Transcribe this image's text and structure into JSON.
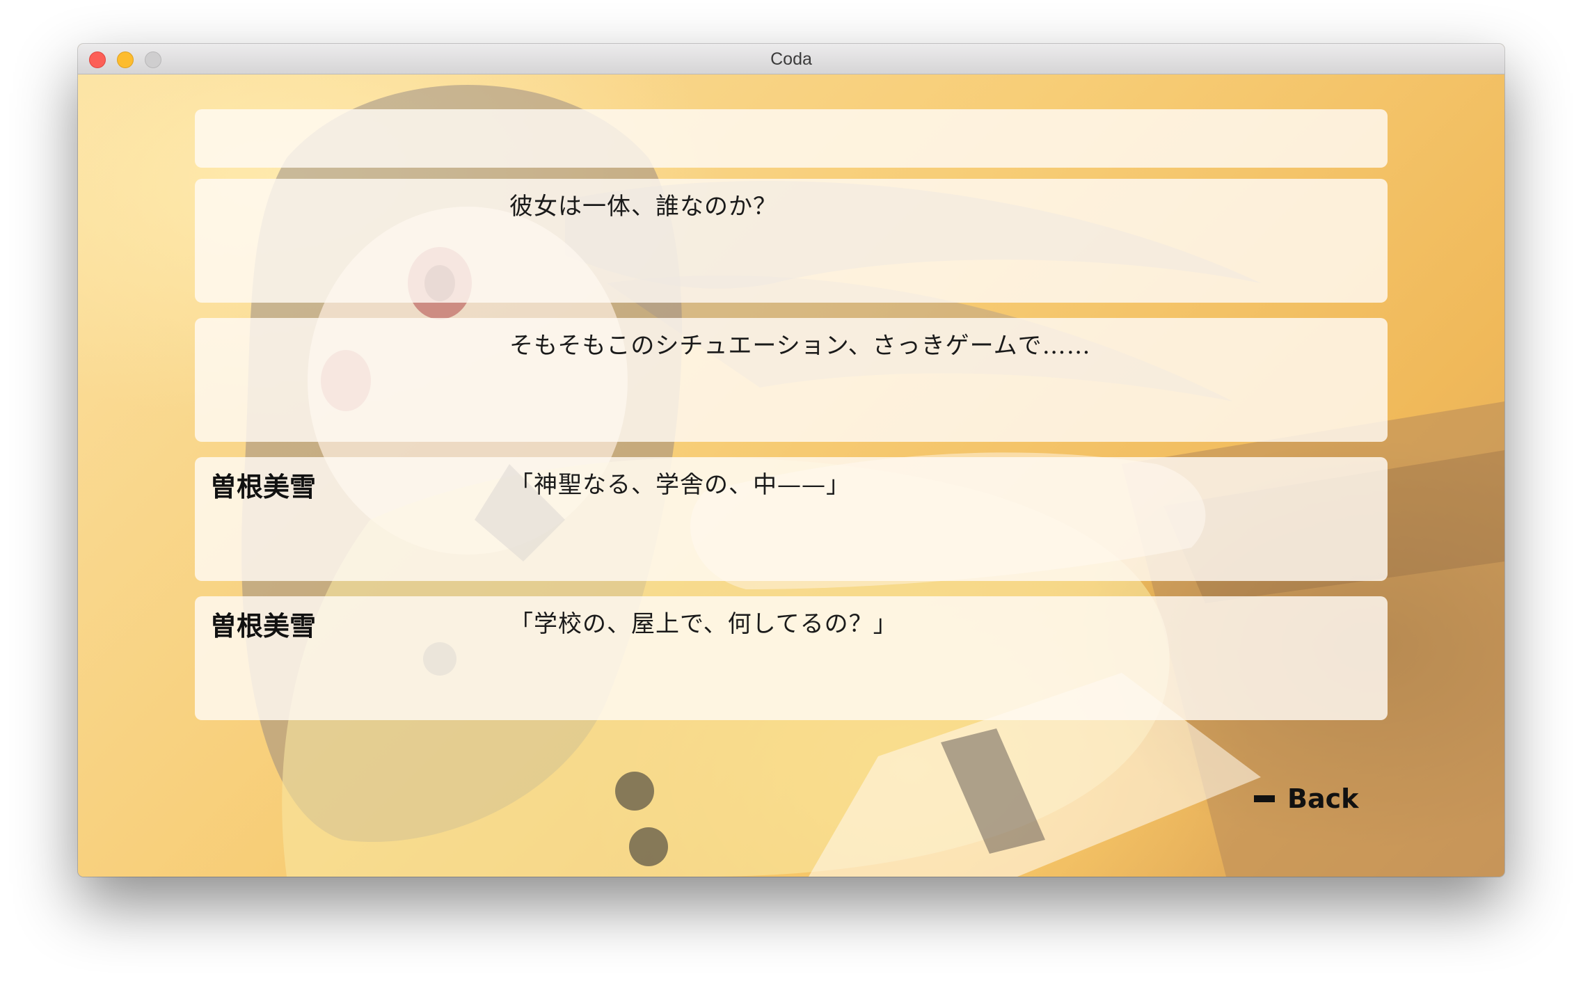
{
  "window": {
    "title": "Coda"
  },
  "history_log": [
    {
      "speaker": "",
      "text": ""
    },
    {
      "speaker": "",
      "text": "彼女は一体、誰なのか？"
    },
    {
      "speaker": "",
      "text": "そもそもこのシチュエーション、さっきゲームで……"
    },
    {
      "speaker": "曽根美雪",
      "text": "「神聖なる、学舎の、中——」"
    },
    {
      "speaker": "曽根美雪",
      "text": "「学校の、屋上で、何してるの？」"
    }
  ],
  "controls": {
    "back_label": "Back",
    "back_icon": "minus-bar-icon"
  },
  "colors": {
    "background_accent": "#f6c66a",
    "panel": "#fffaf4",
    "text": "#111111"
  }
}
